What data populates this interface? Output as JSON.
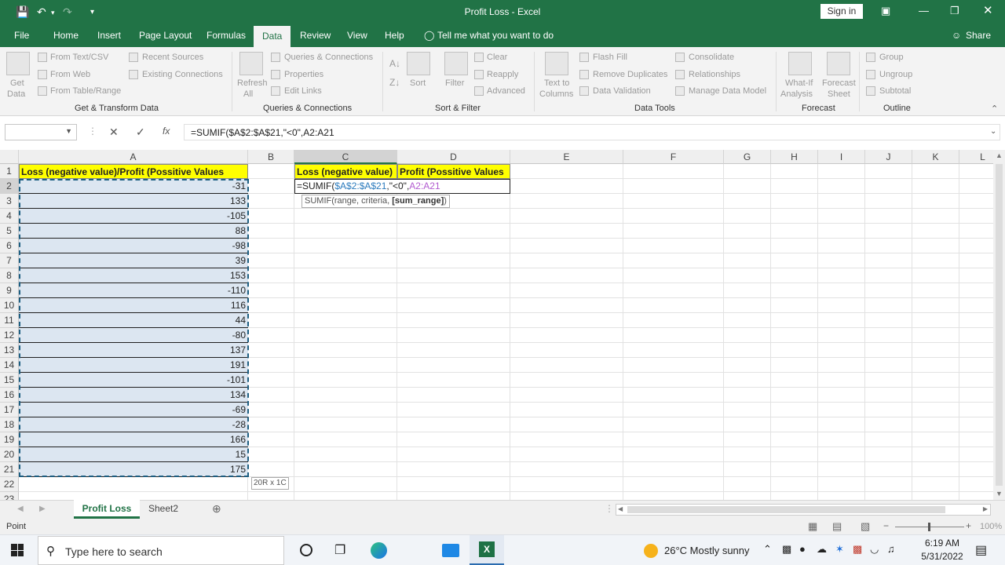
{
  "title_bar": {
    "title": "Profit Loss  -  Excel",
    "sign_in": "Sign in"
  },
  "tabs": [
    "File",
    "Home",
    "Insert",
    "Page Layout",
    "Formulas",
    "Data",
    "Review",
    "View",
    "Help"
  ],
  "active_tab": "Data",
  "tell_me": "Tell me what you want to do",
  "share": "Share",
  "ribbon": {
    "get_transform": {
      "get_data": "Get",
      "get_data2": "Data",
      "from_text": "From Text/CSV",
      "from_web": "From Web",
      "from_table": "From Table/Range",
      "recent": "Recent Sources",
      "existing": "Existing Connections",
      "label": "Get & Transform Data"
    },
    "queries": {
      "refresh": "Refresh",
      "refresh2": "All",
      "qc": "Queries & Connections",
      "props": "Properties",
      "edit_links": "Edit Links",
      "label": "Queries & Connections"
    },
    "sort_filter": {
      "sort": "Sort",
      "filter": "Filter",
      "clear": "Clear",
      "reapply": "Reapply",
      "advanced": "Advanced",
      "label": "Sort & Filter"
    },
    "data_tools": {
      "ttc": "Text to",
      "ttc2": "Columns",
      "flash": "Flash Fill",
      "dupes": "Remove Duplicates",
      "validation": "Data Validation",
      "consolidate": "Consolidate",
      "relationships": "Relationships",
      "model": "Manage Data Model",
      "label": "Data Tools"
    },
    "forecast": {
      "whatif": "What-If",
      "whatif2": "Analysis",
      "sheet": "Forecast",
      "sheet2": "Sheet",
      "label": "Forecast"
    },
    "outline": {
      "group": "Group",
      "ungroup": "Ungroup",
      "subtotal": "Subtotal",
      "label": "Outline"
    }
  },
  "formula_bar": {
    "fx": "fx",
    "formula": "=SUMIF($A$2:$A$21,\"<0\",A2:A21"
  },
  "columns": [
    "A",
    "B",
    "C",
    "D",
    "E",
    "F",
    "G",
    "H",
    "I",
    "J",
    "K",
    "L"
  ],
  "rows": [
    "1",
    "2",
    "3",
    "4",
    "5",
    "6",
    "7",
    "8",
    "9",
    "10",
    "11",
    "12",
    "13",
    "14",
    "15",
    "16",
    "17",
    "18",
    "19",
    "20",
    "21",
    "22",
    "23"
  ],
  "cells": {
    "A1": "Loss (negative value)/Profit (Possitive Values",
    "C1": "Loss (negative value)",
    "D1": "Profit (Possitive Values",
    "A_values": [
      "-31",
      "133",
      "-105",
      "88",
      "-98",
      "39",
      "153",
      "-110",
      "116",
      "44",
      "-80",
      "137",
      "191",
      "-101",
      "134",
      "-69",
      "-28",
      "166",
      "15",
      "175"
    ],
    "C2_parts": [
      "=SUMIF(",
      "$A$2:$A$21",
      ",\"<0\",",
      "A2:A21"
    ]
  },
  "tooltip": {
    "prefix": "SUMIF(range, criteria, ",
    "bold": "[sum_range]",
    "suffix": ")"
  },
  "size_hint": "20R x 1C",
  "sheets": [
    "Profit Loss",
    "Sheet2"
  ],
  "status": "Point",
  "zoom": "100%",
  "taskbar": {
    "search": "Type here to search",
    "weather": "26°C  Mostly sunny",
    "time": "6:19 AM",
    "date": "5/31/2022"
  },
  "colors": {
    "excel_green": "#217346",
    "header_yellow": "#ffff00",
    "selection_blue": "#dce6f1"
  }
}
